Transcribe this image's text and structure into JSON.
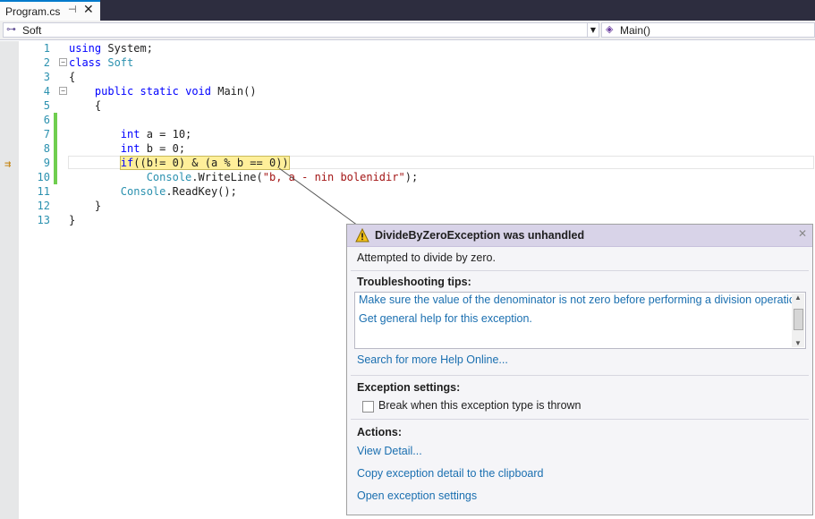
{
  "tab": {
    "title": "Program.cs",
    "pin_icon": "pin-icon",
    "close_icon": "close-icon"
  },
  "navbar": {
    "class_name": "Soft",
    "member_name": "Main()"
  },
  "code": {
    "lines": [
      {
        "num": "1",
        "text": "using System;"
      },
      {
        "num": "2",
        "text": "class Soft"
      },
      {
        "num": "3",
        "text": "{"
      },
      {
        "num": "4",
        "text": "    public static void Main()"
      },
      {
        "num": "5",
        "text": "    {"
      },
      {
        "num": "6",
        "text": ""
      },
      {
        "num": "7",
        "text": "        int a = 10;"
      },
      {
        "num": "8",
        "text": "        int b = 0;"
      },
      {
        "num": "9",
        "text": "        if((b!= 0) & (a % b == 0))"
      },
      {
        "num": "10",
        "text": "            Console.WriteLine(\"b, a - nin bolenidir\");"
      },
      {
        "num": "11",
        "text": "        Console.ReadKey();"
      },
      {
        "num": "12",
        "text": "    }"
      },
      {
        "num": "13",
        "text": "}"
      }
    ]
  },
  "exception": {
    "title": "DivideByZeroException was unhandled",
    "message": "Attempted to divide by zero.",
    "tips_heading": "Troubleshooting tips:",
    "tips": [
      "Make sure the value of the denominator is not zero before performing a division operation.",
      "Get general help for this exception."
    ],
    "search_link": "Search for more Help Online...",
    "settings_heading": "Exception settings:",
    "break_checkbox": "Break when this exception type is thrown",
    "actions_heading": "Actions:",
    "actions": [
      "View Detail...",
      "Copy exception detail to the clipboard",
      "Open exception settings"
    ]
  },
  "colors": {
    "keyword": "#0000ff",
    "type": "#2b91af",
    "string": "#a31515",
    "highlight": "#ffef9a",
    "link": "#1a6fb0"
  }
}
